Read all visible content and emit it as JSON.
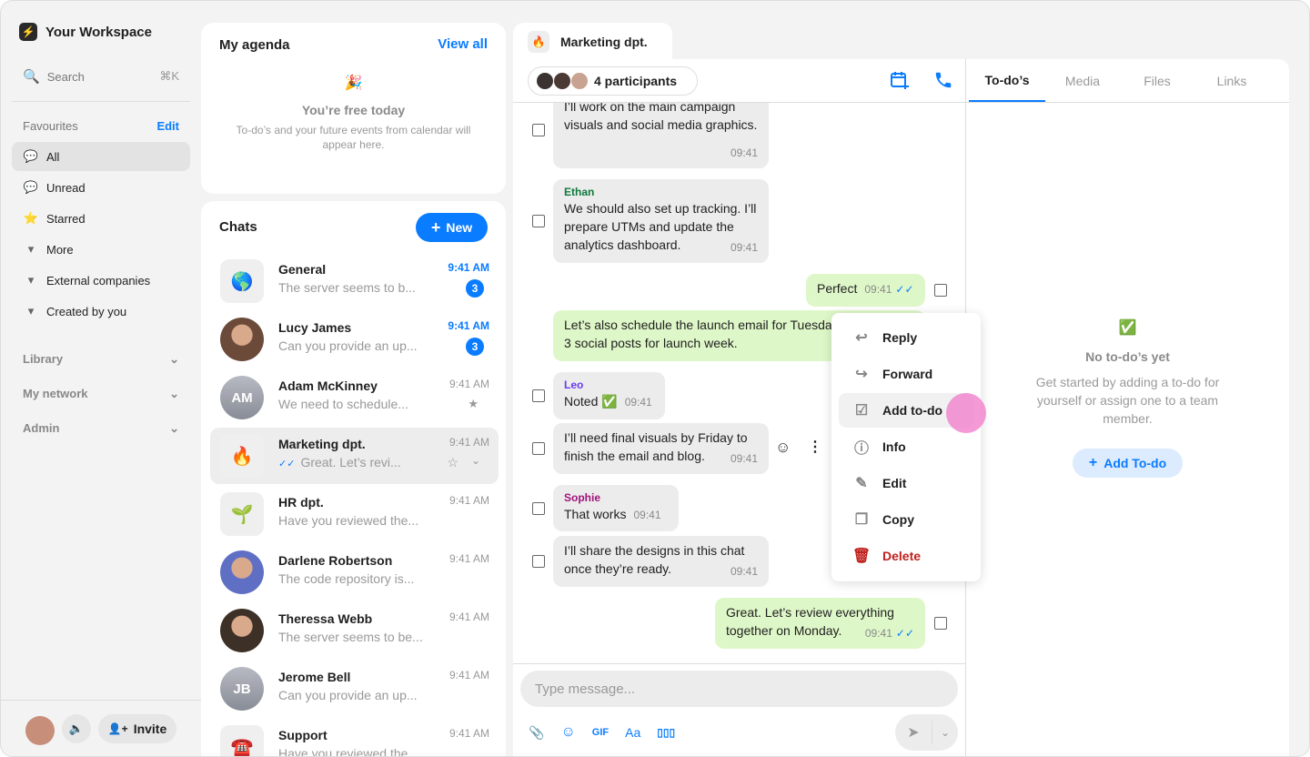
{
  "sidebar": {
    "workspace": "Your Workspace",
    "search": "Search",
    "shortcut": "⌘K",
    "favourites": "Favourites",
    "edit": "Edit",
    "items": [
      {
        "label": "All",
        "icon": "speech-bubble-icon"
      },
      {
        "label": "Unread",
        "icon": "unread-bubble-icon"
      },
      {
        "label": "Starred",
        "icon": "star-icon"
      },
      {
        "label": "More",
        "icon": "caret-icon"
      },
      {
        "label": "External companies",
        "icon": "caret-icon"
      },
      {
        "label": "Created by you",
        "icon": "caret-icon"
      }
    ],
    "sections": [
      "Library",
      "My network",
      "Admin"
    ],
    "invite": "Invite"
  },
  "agenda": {
    "title": "My agenda",
    "view_all": "View all",
    "empty_title": "You’re free today",
    "empty_text": "To-do’s and your future events from calendar will appear here."
  },
  "chats": {
    "title": "Chats",
    "new": "New",
    "list": [
      {
        "name": "General",
        "preview": "The server seems to b...",
        "time": "9:41 AM",
        "unread": "3",
        "icon": "🌎",
        "type": "square"
      },
      {
        "name": "Lucy James",
        "preview": "Can you provide an up...",
        "time": "9:41 AM",
        "unread": "3",
        "type": "photo",
        "color": "#6b4a3a"
      },
      {
        "name": "Adam McKinney",
        "preview": "We need to schedule...",
        "time": "9:41 AM",
        "initials": "AM",
        "type": "initials",
        "starred": true
      },
      {
        "name": "Marketing dpt.",
        "preview": "Great. Let’s revi...",
        "time": "9:41 AM",
        "icon": "🔥",
        "type": "square",
        "selected": true
      },
      {
        "name": "HR dpt.",
        "preview": "Have you reviewed the...",
        "time": "9:41 AM",
        "icon": "🌱",
        "type": "square"
      },
      {
        "name": "Darlene Robertson",
        "preview": "The code repository is...",
        "time": "9:41 AM",
        "type": "photo",
        "color": "#5f6fc4"
      },
      {
        "name": "Theressa Webb",
        "preview": "The server seems to be...",
        "time": "9:41 AM",
        "type": "photo",
        "color": "#3d3026"
      },
      {
        "name": "Jerome Bell",
        "preview": "Can you provide an up...",
        "time": "9:41 AM",
        "initials": "JB",
        "type": "initials"
      },
      {
        "name": "Support",
        "preview": "Have you reviewed the...",
        "time": "9:41 AM",
        "icon": "☎️",
        "type": "square"
      }
    ]
  },
  "conversation": {
    "tab": "Marketing dpt.",
    "tab_icon": "🔥",
    "participants": "4 participants",
    "placeholder": "Type message...",
    "gif": "GIF",
    "font": "Aa",
    "messages": [
      {
        "text": "I’ll work on the main campaign visuals and social media graphics.",
        "time": "09:41",
        "out": false
      },
      {
        "sender": "Ethan",
        "sender_color": "#0f7a3c",
        "text": "We should also set up tracking. I’ll prepare UTMs and update the analytics dashboard.",
        "time": "09:41",
        "out": false
      },
      {
        "text": "Perfect",
        "time": "09:41",
        "out": true
      },
      {
        "text": "Let’s also schedule the launch email for Tuesday and line up 3 social posts for launch week.",
        "out": true
      },
      {
        "sender": "Leo",
        "sender_color": "#6b3bf0",
        "text": "Noted ✅",
        "time": "09:41",
        "out": false
      },
      {
        "text": "I’ll need final visuals by Friday to finish the email and blog.",
        "time": "09:41",
        "out": false
      },
      {
        "sender": "Sophie",
        "sender_color": "#a0147a",
        "text": "That works",
        "time": "09:41",
        "out": false
      },
      {
        "text": "I’ll share the designs in this chat once they’re ready.",
        "time": "09:41",
        "out": false
      },
      {
        "text": "Great. Let’s review everything together on Monday.",
        "time": "09:41",
        "out": true
      }
    ]
  },
  "context_menu": [
    {
      "label": "Reply",
      "icon": "reply-icon"
    },
    {
      "label": "Forward",
      "icon": "forward-icon"
    },
    {
      "label": "Add to-do",
      "icon": "checklist-icon"
    },
    {
      "label": "Info",
      "icon": "info-icon"
    },
    {
      "label": "Edit",
      "icon": "pencil-icon"
    },
    {
      "label": "Copy",
      "icon": "copy-icon"
    },
    {
      "label": "Delete",
      "icon": "trash-icon"
    }
  ],
  "right_panel": {
    "tabs": [
      "To-do’s",
      "Media",
      "Files",
      "Links"
    ],
    "empty_title": "No to-do’s yet",
    "empty_text": "Get started by adding a to-do for yourself or assign one to a team member.",
    "add": "Add To-do"
  },
  "colors": {
    "accent": "#0a7cff",
    "danger": "#c0201d",
    "outgoing": "#def7c8"
  }
}
